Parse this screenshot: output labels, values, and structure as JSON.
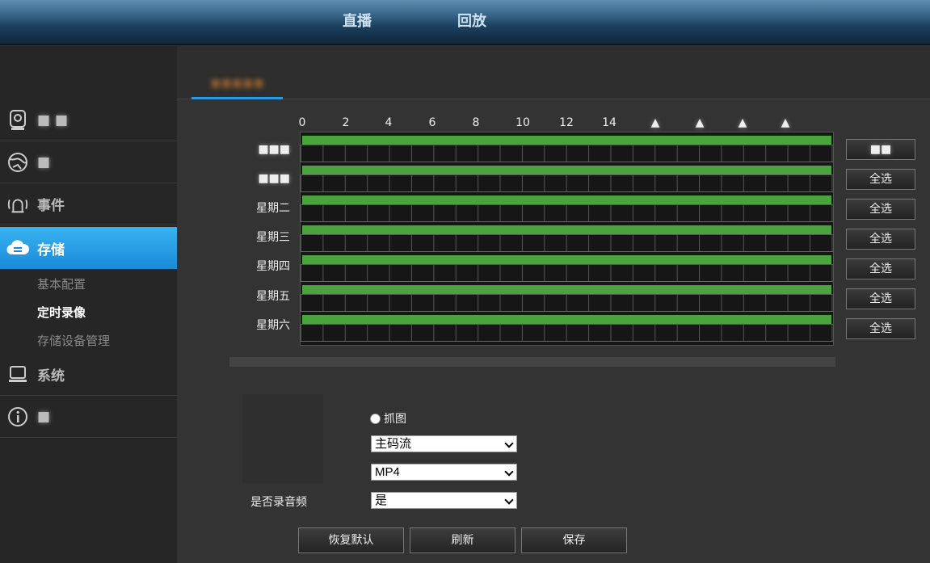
{
  "header": {
    "nav": [
      "直播",
      "回放"
    ]
  },
  "sidebar": {
    "items": [
      {
        "label": "",
        "icon": "camera-icon"
      },
      {
        "label": "",
        "icon": "globe-icon"
      },
      {
        "label": "事件",
        "icon": "alarm-icon"
      },
      {
        "label": "存储",
        "icon": "cloud-storage-icon"
      },
      {
        "label": "系统",
        "icon": "computer-icon"
      },
      {
        "label": "",
        "icon": "info-icon"
      }
    ],
    "sub_items": [
      "基本配置",
      "定时录像",
      "存储设备管理"
    ],
    "current_sub": "定时录像"
  },
  "tab": {
    "label": ""
  },
  "schedule": {
    "hours": [
      "0",
      "2",
      "4",
      "6",
      "8",
      "10",
      "12",
      "14"
    ],
    "days": [
      "",
      "",
      "星期二",
      "星期三",
      "星期四",
      "星期五",
      "星期六"
    ],
    "select_all": [
      "",
      "全选",
      "全选",
      "全选",
      "全选",
      "全选",
      "全选"
    ]
  },
  "form": {
    "capture_label": "抓图",
    "stream_value": "主码流",
    "format_value": "MP4",
    "audio_label": "是否录音频",
    "audio_value": "是"
  },
  "buttons": {
    "restore": "恢复默认",
    "refresh": "刷新",
    "save": "保存"
  },
  "colors": {
    "accent": "#2a9be3",
    "schedule_bar": "#4aa33d",
    "active_sidebar": "#1a8ad8"
  }
}
